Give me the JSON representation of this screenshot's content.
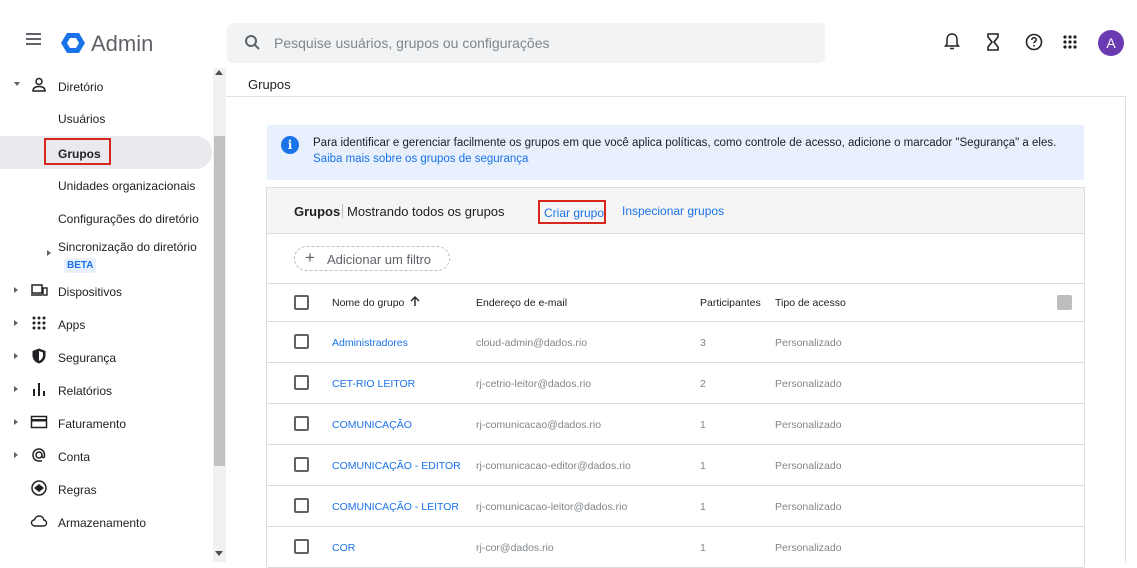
{
  "header": {
    "app_title": "Admin",
    "search_placeholder": "Pesquise usuários, grupos ou configurações",
    "avatar_initial": "A",
    "icons": [
      "menu-icon",
      "admin-logo-icon",
      "search-icon",
      "bell-icon",
      "hourglass-icon",
      "help-icon",
      "apps-grid-icon"
    ]
  },
  "sidebar": {
    "diretorio": "Diretório",
    "usuarios": "Usuários",
    "grupos": "Grupos",
    "unidades": "Unidades organizacionais",
    "config_dir": "Configurações do diretório",
    "sincronizacao": "Sincronização do diretório",
    "beta": "BETA",
    "dispositivos": "Dispositivos",
    "apps": "Apps",
    "seguranca": "Segurança",
    "relatorios": "Relatórios",
    "faturamento": "Faturamento",
    "conta": "Conta",
    "regras": "Regras",
    "armazenamento": "Armazenamento"
  },
  "main": {
    "breadcrumb": "Grupos",
    "banner_text": "Para identificar e gerenciar facilmente os grupos em que você aplica políticas, como controle de acesso, adicione o marcador \"Segurança\" a eles.",
    "banner_link": "Saiba mais sobre os grupos de segurança",
    "card_title": "Grupos",
    "card_subtitle": "Mostrando todos os grupos",
    "create_group": "Criar grupo",
    "inspect_groups": "Inspecionar grupos",
    "add_filter": "Adicionar um filtro",
    "columns": {
      "name": "Nome do grupo",
      "email": "Endereço de e-mail",
      "members": "Participantes",
      "access": "Tipo de acesso"
    },
    "rows": [
      {
        "name": "Administradores",
        "email": "cloud-admin@dados.rio",
        "members": "3",
        "access": "Personalizado"
      },
      {
        "name": "CET-RIO LEITOR",
        "email": "rj-cetrio-leitor@dados.rio",
        "members": "2",
        "access": "Personalizado"
      },
      {
        "name": "COMUNICAÇÃO",
        "email": "rj-comunicacao@dados.rio",
        "members": "1",
        "access": "Personalizado"
      },
      {
        "name": "COMUNICAÇÃO - EDITOR",
        "email": "rj-comunicacao-editor@dados.rio",
        "members": "1",
        "access": "Personalizado"
      },
      {
        "name": "COMUNICAÇÃO - LEITOR",
        "email": "rj-comunicacao-leitor@dados.rio",
        "members": "1",
        "access": "Personalizado"
      },
      {
        "name": "COR",
        "email": "rj-cor@dados.rio",
        "members": "1",
        "access": "Personalizado"
      }
    ]
  },
  "colors": {
    "accent": "#1a73e8",
    "avatar": "#6a3ab2",
    "highlight_border": "#d7261e",
    "banner_bg": "#e8f0fe"
  }
}
